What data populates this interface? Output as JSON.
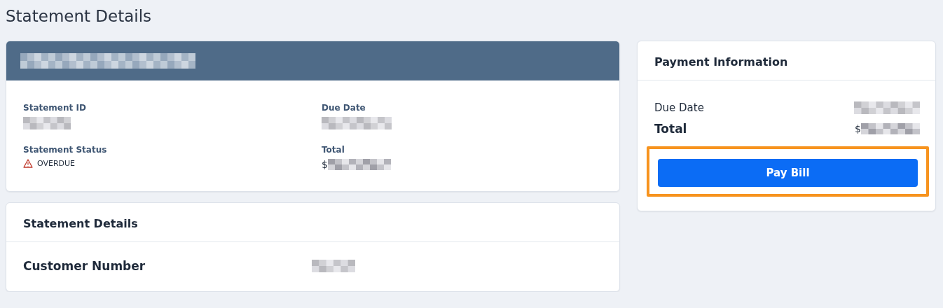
{
  "page": {
    "title": "Statement Details"
  },
  "summary": {
    "header": {
      "redacted": true
    },
    "fields": [
      {
        "label": "Statement ID",
        "kind": "redacted"
      },
      {
        "label": "Due Date",
        "kind": "redacted"
      },
      {
        "label": "Statement Status",
        "kind": "status",
        "status": "OVERDUE"
      },
      {
        "label": "Total",
        "kind": "amount",
        "prefix": "$"
      }
    ]
  },
  "details": {
    "title": "Statement Details",
    "rows": [
      {
        "label": "Customer Number",
        "kind": "redacted"
      }
    ]
  },
  "payment": {
    "title": "Payment Information",
    "rows": [
      {
        "label": "Due Date",
        "kind": "redacted",
        "emphasis": false
      },
      {
        "label": "Total",
        "kind": "amount",
        "prefix": "$",
        "emphasis": true
      }
    ],
    "button": {
      "label": "Pay Bill",
      "highlighted": true
    }
  }
}
